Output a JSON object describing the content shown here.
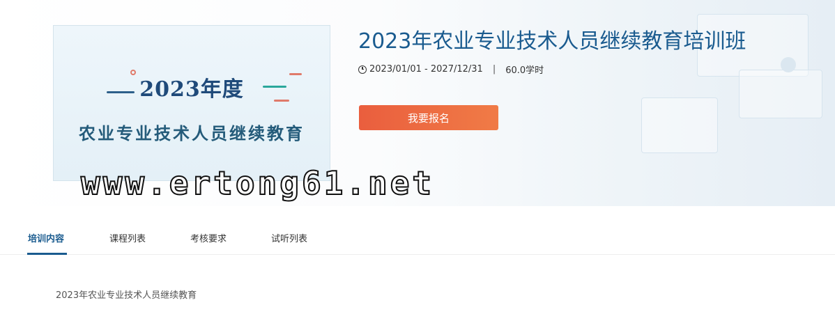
{
  "course": {
    "title": "2023年农业专业技术人员继续教育培训班",
    "date_range": "2023/01/01 - 2027/12/31",
    "separator": "|",
    "hours": "60.0学时",
    "enroll_label": "我要报名"
  },
  "cover": {
    "year_text": "2023年度",
    "subtitle": "农业专业技术人员继续教育"
  },
  "watermark": "www.ertong61.net",
  "tabs": [
    {
      "label": "培训内容",
      "active": true
    },
    {
      "label": "课程列表",
      "active": false
    },
    {
      "label": "考核要求",
      "active": false
    },
    {
      "label": "试听列表",
      "active": false
    }
  ],
  "content": {
    "text": "2023年农业专业技术人员继续教育"
  },
  "colors": {
    "accent": "#1a5b8f",
    "button": "#ee6a42"
  }
}
